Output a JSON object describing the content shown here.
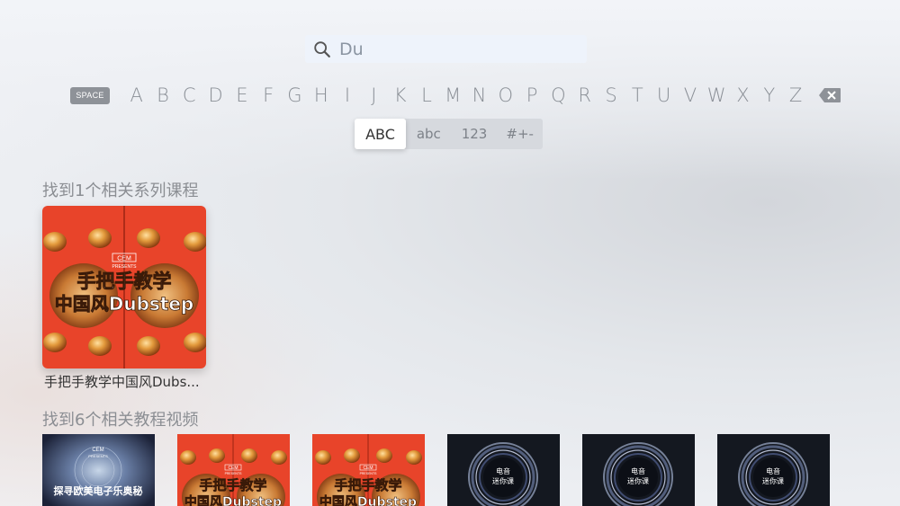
{
  "search": {
    "value": "Du"
  },
  "keyboard": {
    "space_label": "SPACE",
    "letters": [
      "A",
      "B",
      "C",
      "D",
      "E",
      "F",
      "G",
      "H",
      "I",
      "J",
      "K",
      "L",
      "M",
      "N",
      "O",
      "P",
      "Q",
      "R",
      "S",
      "T",
      "U",
      "V",
      "W",
      "X",
      "Y",
      "Z"
    ]
  },
  "modes": [
    {
      "label": "ABC",
      "selected": true
    },
    {
      "label": "abc",
      "selected": false
    },
    {
      "label": "123",
      "selected": false
    },
    {
      "label": "#+-",
      "selected": false
    }
  ],
  "series_section": {
    "header": "找到1个相关系列课程",
    "card": {
      "title": "手把手教学中国风Dubs...",
      "art_brand": "CEM",
      "art_presents": "PRESENTS",
      "art_line1": "手把手教学",
      "art_line2": "中国风Dubstep"
    }
  },
  "video_section": {
    "header": "找到6个相关教程视频",
    "videos": [
      {
        "style": "galaxy",
        "brand": "CEM",
        "presents": "PRESENTS",
        "text": "探寻欧美电子乐奥秘"
      },
      {
        "style": "red",
        "brand": "CEM",
        "presents": "PRESENTS",
        "line1": "手把手教学",
        "line2": "中国风Dubstep"
      },
      {
        "style": "red",
        "brand": "CEM",
        "presents": "PRESENTS",
        "line1": "手把手教学",
        "line2": "中国风Dubstep"
      },
      {
        "style": "ring",
        "line1": "电音",
        "line2": "迷你课"
      },
      {
        "style": "ring",
        "line1": "电音",
        "line2": "迷你课"
      },
      {
        "style": "ring",
        "line1": "电音",
        "line2": "迷你课"
      }
    ]
  },
  "colors": {
    "red_art": "#e8442a",
    "gold": "#e39a3c",
    "keyboard_text": "#8a8f96"
  }
}
